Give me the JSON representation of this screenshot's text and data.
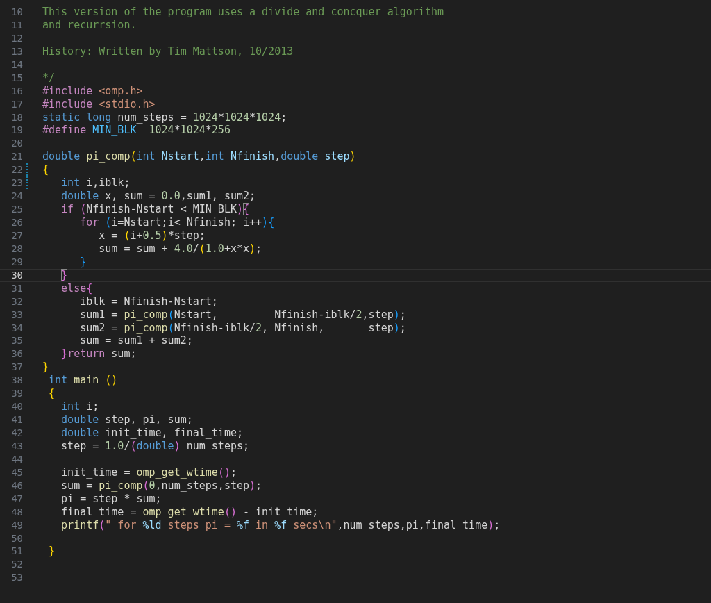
{
  "editor": {
    "lines": [
      {
        "number": "10",
        "tokens": [
          {
            "text": "This version of the program uses a divide and concquer algorithm",
            "kind": "comment"
          }
        ]
      },
      {
        "number": "11",
        "tokens": [
          {
            "text": "and recurrsion.",
            "kind": "comment"
          }
        ]
      },
      {
        "number": "12"
      },
      {
        "number": "13",
        "tokens": [
          {
            "text": "History: Written by Tim Mattson, 10/2013",
            "kind": "comment"
          }
        ]
      },
      {
        "number": "14"
      },
      {
        "number": "15",
        "tokens": [
          {
            "text": "*/",
            "kind": "comment"
          }
        ]
      },
      {
        "number": "16",
        "tokens": [
          {
            "text": "#include",
            "kind": "preproc"
          },
          {
            "text": " <omp.h>",
            "kind": "string"
          }
        ]
      },
      {
        "number": "17",
        "tokens": [
          {
            "text": "#include",
            "kind": "preproc"
          },
          {
            "text": " <stdio.h>",
            "kind": "string"
          }
        ]
      },
      {
        "number": "18",
        "tokens": [
          {
            "text": "static",
            "kind": "type"
          },
          {
            "text": " long",
            "kind": "type"
          },
          {
            "text": " num_steps = ",
            "kind": "plain"
          },
          {
            "text": "1024",
            "kind": "number"
          },
          {
            "text": "*",
            "kind": "plain"
          },
          {
            "text": "1024",
            "kind": "number"
          },
          {
            "text": "*",
            "kind": "plain"
          },
          {
            "text": "1024",
            "kind": "number"
          },
          {
            "text": ";",
            "kind": "plain"
          }
        ]
      },
      {
        "number": "19",
        "tokens": [
          {
            "text": "#define",
            "kind": "preproc"
          },
          {
            "text": " MIN_BLK",
            "kind": "macro"
          },
          {
            "text": "  1024",
            "kind": "number"
          },
          {
            "text": "*",
            "kind": "plain"
          },
          {
            "text": "1024",
            "kind": "number"
          },
          {
            "text": "*",
            "kind": "plain"
          },
          {
            "text": "256",
            "kind": "number"
          }
        ]
      },
      {
        "number": "20"
      },
      {
        "number": "21",
        "tokens": [
          {
            "text": "double",
            "kind": "type"
          },
          {
            "text": " pi_comp",
            "kind": "function"
          },
          {
            "text": "(",
            "kind": "bracket1"
          },
          {
            "text": "int",
            "kind": "type"
          },
          {
            "text": " Nstart",
            "kind": "param"
          },
          {
            "text": ",",
            "kind": "plain"
          },
          {
            "text": "int",
            "kind": "type"
          },
          {
            "text": " Nfinish",
            "kind": "param"
          },
          {
            "text": ",",
            "kind": "plain"
          },
          {
            "text": "double",
            "kind": "type"
          },
          {
            "text": " step",
            "kind": "param"
          },
          {
            "text": ")",
            "kind": "bracket1"
          }
        ]
      },
      {
        "number": "22",
        "modified": true,
        "tokens": [
          {
            "text": "{",
            "kind": "bracket1"
          }
        ]
      },
      {
        "number": "23",
        "modified": true,
        "tokens": [
          {
            "text": "   int",
            "kind": "type"
          },
          {
            "text": " i,iblk;",
            "kind": "plain"
          }
        ]
      },
      {
        "number": "24",
        "tokens": [
          {
            "text": "   double",
            "kind": "type"
          },
          {
            "text": " x, sum = ",
            "kind": "plain"
          },
          {
            "text": "0.0",
            "kind": "number"
          },
          {
            "text": ",sum1, sum2;",
            "kind": "plain"
          }
        ]
      },
      {
        "number": "25",
        "tokens": [
          {
            "text": "   if",
            "kind": "control"
          },
          {
            "text": " (",
            "kind": "bracket2"
          },
          {
            "text": "Nfinish-Nstart < MIN_BLK",
            "kind": "plain"
          },
          {
            "text": ")",
            "kind": "bracket2"
          },
          {
            "text": "{",
            "kind": "bracket2",
            "matched": true
          }
        ]
      },
      {
        "number": "26",
        "tokens": [
          {
            "text": "      for",
            "kind": "control"
          },
          {
            "text": " (",
            "kind": "bracket3"
          },
          {
            "text": "i=Nstart;i< Nfinish; i++",
            "kind": "plain"
          },
          {
            "text": ")",
            "kind": "bracket3"
          },
          {
            "text": "{",
            "kind": "bracket3"
          }
        ]
      },
      {
        "number": "27",
        "tokens": [
          {
            "text": "         x = ",
            "kind": "plain"
          },
          {
            "text": "(",
            "kind": "bracket1"
          },
          {
            "text": "i+",
            "kind": "plain"
          },
          {
            "text": "0.5",
            "kind": "number"
          },
          {
            "text": ")",
            "kind": "bracket1"
          },
          {
            "text": "*step;",
            "kind": "plain"
          }
        ]
      },
      {
        "number": "28",
        "tokens": [
          {
            "text": "         sum = sum + ",
            "kind": "plain"
          },
          {
            "text": "4.0",
            "kind": "number"
          },
          {
            "text": "/",
            "kind": "plain"
          },
          {
            "text": "(",
            "kind": "bracket1"
          },
          {
            "text": "1.0",
            "kind": "number"
          },
          {
            "text": "+x*x",
            "kind": "plain"
          },
          {
            "text": ")",
            "kind": "bracket1"
          },
          {
            "text": ";",
            "kind": "plain"
          }
        ]
      },
      {
        "number": "29",
        "tokens": [
          {
            "text": "      }",
            "kind": "bracket3"
          }
        ]
      },
      {
        "number": "30",
        "current": true,
        "tokens": [
          {
            "text": "   }",
            "kind": "bracket2",
            "matched": true
          }
        ]
      },
      {
        "number": "31",
        "tokens": [
          {
            "text": "   else",
            "kind": "control"
          },
          {
            "text": "{",
            "kind": "bracket2"
          }
        ]
      },
      {
        "number": "32",
        "tokens": [
          {
            "text": "      iblk = Nfinish-Nstart;",
            "kind": "plain"
          }
        ]
      },
      {
        "number": "33",
        "tokens": [
          {
            "text": "      sum1 = ",
            "kind": "plain"
          },
          {
            "text": "pi_comp",
            "kind": "function"
          },
          {
            "text": "(",
            "kind": "bracket3"
          },
          {
            "text": "Nstart,         Nfinish-iblk/",
            "kind": "plain"
          },
          {
            "text": "2",
            "kind": "number"
          },
          {
            "text": ",step",
            "kind": "plain"
          },
          {
            "text": ")",
            "kind": "bracket3"
          },
          {
            "text": ";",
            "kind": "plain"
          }
        ]
      },
      {
        "number": "34",
        "tokens": [
          {
            "text": "      sum2 = ",
            "kind": "plain"
          },
          {
            "text": "pi_comp",
            "kind": "function"
          },
          {
            "text": "(",
            "kind": "bracket3"
          },
          {
            "text": "Nfinish-iblk/",
            "kind": "plain"
          },
          {
            "text": "2",
            "kind": "number"
          },
          {
            "text": ", Nfinish,       step",
            "kind": "plain"
          },
          {
            "text": ")",
            "kind": "bracket3"
          },
          {
            "text": ";",
            "kind": "plain"
          }
        ]
      },
      {
        "number": "35",
        "tokens": [
          {
            "text": "      sum = sum1 + sum2;",
            "kind": "plain"
          }
        ]
      },
      {
        "number": "36",
        "tokens": [
          {
            "text": "   }",
            "kind": "bracket2"
          },
          {
            "text": "return",
            "kind": "control"
          },
          {
            "text": " sum;",
            "kind": "plain"
          }
        ]
      },
      {
        "number": "37",
        "tokens": [
          {
            "text": "}",
            "kind": "bracket1"
          }
        ]
      },
      {
        "number": "38",
        "tokens": [
          {
            "text": " int",
            "kind": "type"
          },
          {
            "text": " main",
            "kind": "function"
          },
          {
            "text": " ()",
            "kind": "bracket1"
          }
        ]
      },
      {
        "number": "39",
        "tokens": [
          {
            "text": " {",
            "kind": "bracket1"
          }
        ]
      },
      {
        "number": "40",
        "tokens": [
          {
            "text": "   int",
            "kind": "type"
          },
          {
            "text": " i;",
            "kind": "plain"
          }
        ]
      },
      {
        "number": "41",
        "tokens": [
          {
            "text": "   double",
            "kind": "type"
          },
          {
            "text": " step, pi, sum;",
            "kind": "plain"
          }
        ]
      },
      {
        "number": "42",
        "tokens": [
          {
            "text": "   double",
            "kind": "type"
          },
          {
            "text": " init_time, final_time;",
            "kind": "plain"
          }
        ]
      },
      {
        "number": "43",
        "tokens": [
          {
            "text": "   step = ",
            "kind": "plain"
          },
          {
            "text": "1.0",
            "kind": "number"
          },
          {
            "text": "/",
            "kind": "plain"
          },
          {
            "text": "(",
            "kind": "bracket2"
          },
          {
            "text": "double",
            "kind": "type"
          },
          {
            "text": ")",
            "kind": "bracket2"
          },
          {
            "text": " num_steps;",
            "kind": "plain"
          }
        ]
      },
      {
        "number": "44"
      },
      {
        "number": "45",
        "tokens": [
          {
            "text": "   init_time = ",
            "kind": "plain"
          },
          {
            "text": "omp_get_wtime",
            "kind": "function"
          },
          {
            "text": "()",
            "kind": "bracket2"
          },
          {
            "text": ";",
            "kind": "plain"
          }
        ]
      },
      {
        "number": "46",
        "tokens": [
          {
            "text": "   sum = ",
            "kind": "plain"
          },
          {
            "text": "pi_comp",
            "kind": "function"
          },
          {
            "text": "(",
            "kind": "bracket2"
          },
          {
            "text": "0",
            "kind": "number"
          },
          {
            "text": ",num_steps,step",
            "kind": "plain"
          },
          {
            "text": ")",
            "kind": "bracket2"
          },
          {
            "text": ";",
            "kind": "plain"
          }
        ]
      },
      {
        "number": "47",
        "tokens": [
          {
            "text": "   pi = step * sum;",
            "kind": "plain"
          }
        ]
      },
      {
        "number": "48",
        "tokens": [
          {
            "text": "   final_time = ",
            "kind": "plain"
          },
          {
            "text": "omp_get_wtime",
            "kind": "function"
          },
          {
            "text": "()",
            "kind": "bracket2"
          },
          {
            "text": " - init_time;",
            "kind": "plain"
          }
        ]
      },
      {
        "number": "49",
        "tokens": [
          {
            "text": "   printf",
            "kind": "function"
          },
          {
            "text": "(",
            "kind": "bracket2"
          },
          {
            "text": "\" for ",
            "kind": "string"
          },
          {
            "text": "%ld",
            "kind": "format"
          },
          {
            "text": " steps pi = ",
            "kind": "string"
          },
          {
            "text": "%f",
            "kind": "format"
          },
          {
            "text": " in ",
            "kind": "string"
          },
          {
            "text": "%f",
            "kind": "format"
          },
          {
            "text": " secs\\n\"",
            "kind": "string"
          },
          {
            "text": ",num_steps,pi,final_time",
            "kind": "plain"
          },
          {
            "text": ")",
            "kind": "bracket2"
          },
          {
            "text": ";",
            "kind": "plain"
          }
        ]
      },
      {
        "number": "50"
      },
      {
        "number": "51",
        "tokens": [
          {
            "text": " }",
            "kind": "bracket1"
          }
        ]
      },
      {
        "number": "52"
      },
      {
        "number": "53"
      }
    ]
  }
}
